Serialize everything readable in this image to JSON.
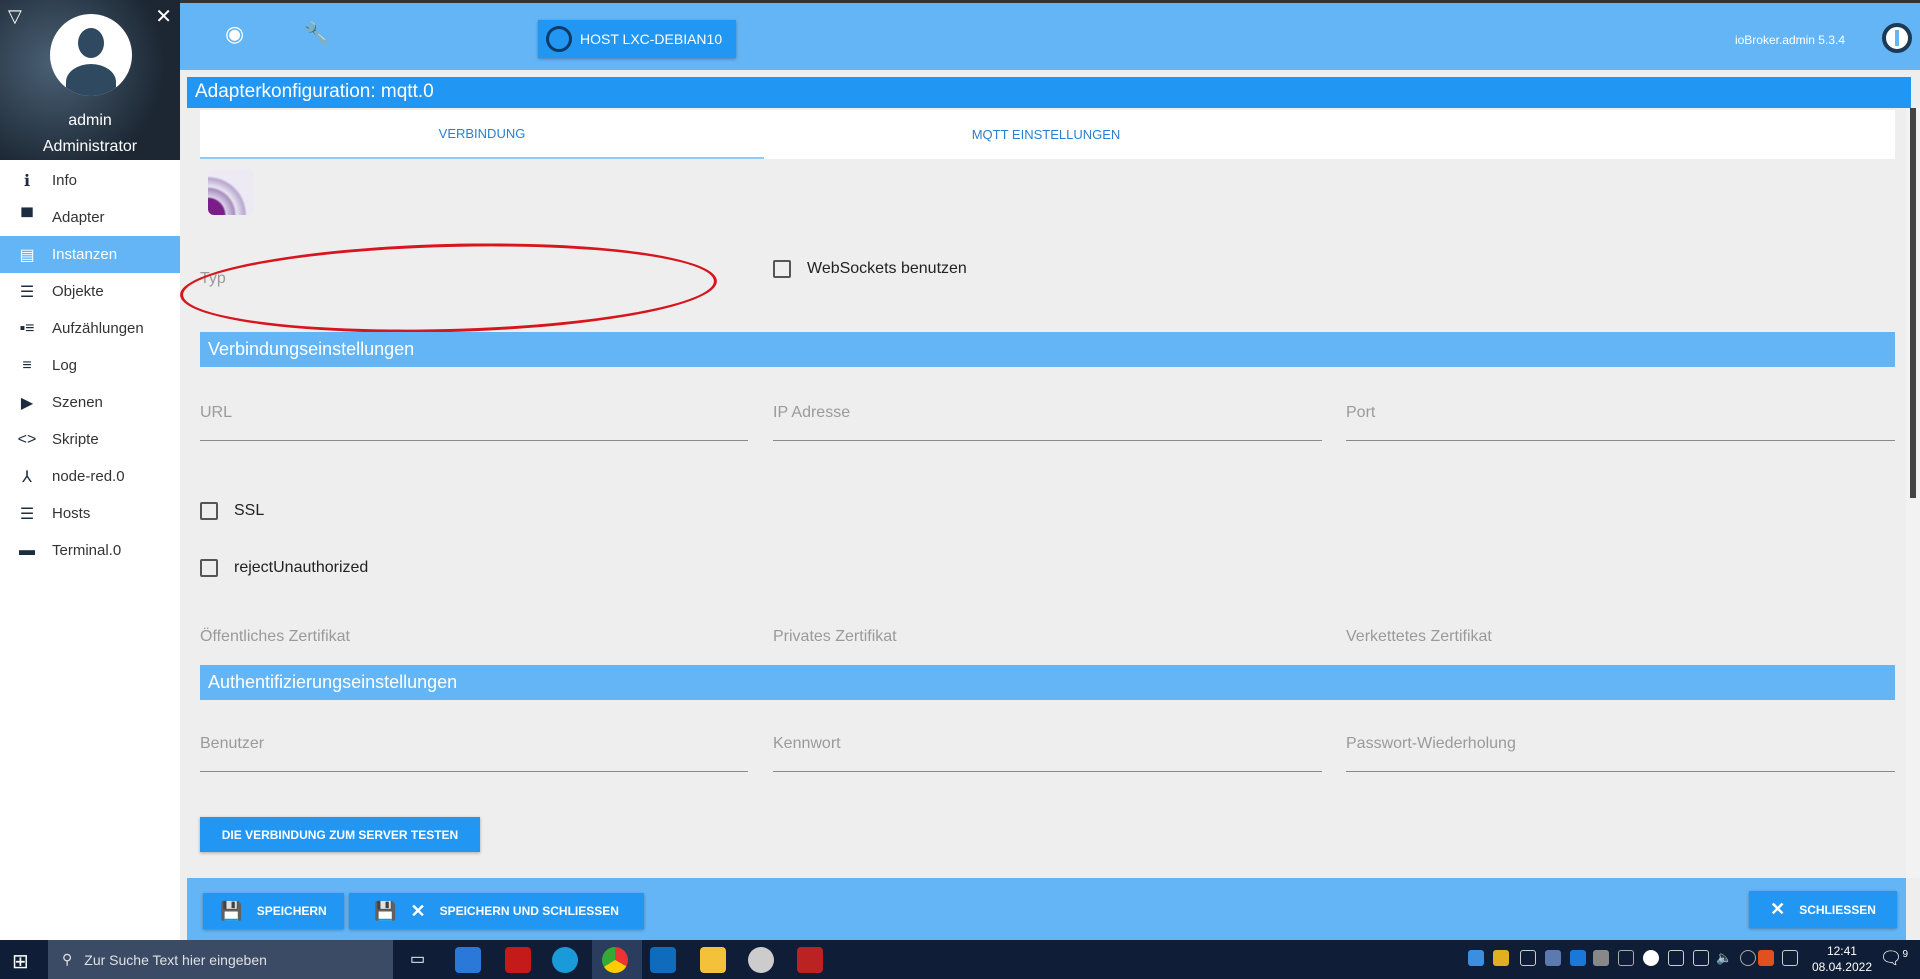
{
  "user": {
    "name": "admin",
    "role": "Administrator"
  },
  "sidebar": {
    "items": [
      {
        "label": "Info",
        "icon": "info-icon"
      },
      {
        "label": "Adapter",
        "icon": "store-icon"
      },
      {
        "label": "Instanzen",
        "icon": "instances-icon",
        "active": true
      },
      {
        "label": "Objekte",
        "icon": "list-icon"
      },
      {
        "label": "Aufzählungen",
        "icon": "enum-icon"
      },
      {
        "label": "Log",
        "icon": "log-icon"
      },
      {
        "label": "Szenen",
        "icon": "scenes-icon"
      },
      {
        "label": "Skripte",
        "icon": "code-icon"
      },
      {
        "label": "node-red.0",
        "icon": "node-red-icon"
      },
      {
        "label": "Hosts",
        "icon": "hosts-icon"
      },
      {
        "label": "Terminal.0",
        "icon": "terminal-icon"
      }
    ]
  },
  "header": {
    "host": "HOST LXC-DEBIAN10",
    "version": "ioBroker.admin 5.3.4"
  },
  "title": "Adapterkonfiguration: mqtt.0",
  "tabs": [
    "VERBINDUNG",
    "MQTT EINSTELLUNGEN"
  ],
  "form": {
    "typ": "Typ",
    "websockets": "WebSockets benutzen",
    "section1": "Verbindungseinstellungen",
    "url": "URL",
    "ip": "IP Adresse",
    "port": "Port",
    "ssl": "SSL",
    "reject": "rejectUnauthorized",
    "pubcert": "Öffentliches Zertifikat",
    "privcert": "Privates Zertifikat",
    "chaincert": "Verkettetes Zertifikat",
    "section2": "Authentifizierungseinstellungen",
    "user": "Benutzer",
    "password": "Kennwort",
    "password2": "Passwort-Wiederholung",
    "test": "DIE VERBINDUNG ZUM SERVER TESTEN"
  },
  "footer": {
    "save": "SPEICHERN",
    "save_close": "SPEICHERN UND SCHLIESSEN",
    "close": "SCHLIESSEN"
  },
  "taskbar": {
    "search": "Zur Suche Text hier eingeben",
    "time": "12:41",
    "date": "08.04.2022",
    "notifications": "9"
  }
}
